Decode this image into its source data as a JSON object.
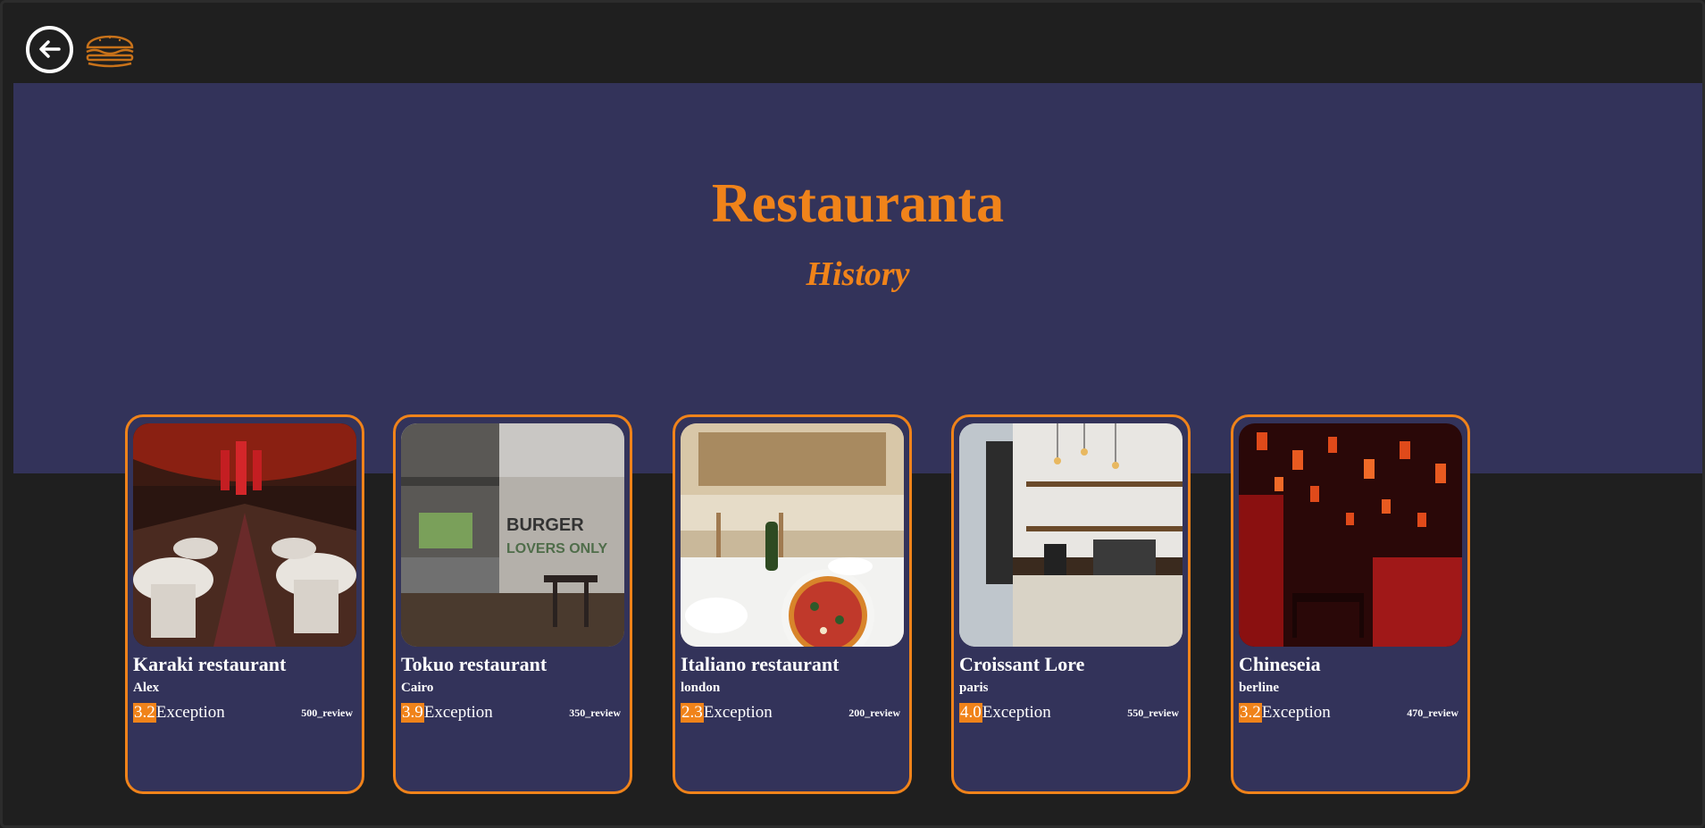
{
  "header": {
    "back_icon": "arrow-left-circle-icon",
    "logo_icon": "burger-icon"
  },
  "hero": {
    "title": "Restauranta",
    "subtitle": "History",
    "background": "#33335a",
    "accent": "#f0831a"
  },
  "cards": [
    {
      "name": "Karaki restaurant",
      "city": "Alex",
      "rating": "3.2",
      "rating_label": "Exception",
      "reviews": "500_review"
    },
    {
      "name": "Tokuo restaurant",
      "city": "Cairo",
      "rating": "3.9",
      "rating_label": "Exception",
      "reviews": "350_review"
    },
    {
      "name": "Italiano restaurant",
      "city": "london",
      "rating": "2.3",
      "rating_label": "Exception",
      "reviews": "200_review"
    },
    {
      "name": "Croissant Lore",
      "city": "paris",
      "rating": "4.0",
      "rating_label": "Exception",
      "reviews": "550_review"
    },
    {
      "name": "Chineseia",
      "city": "berline",
      "rating": "3.2",
      "rating_label": "Exception",
      "reviews": "470_review"
    }
  ]
}
